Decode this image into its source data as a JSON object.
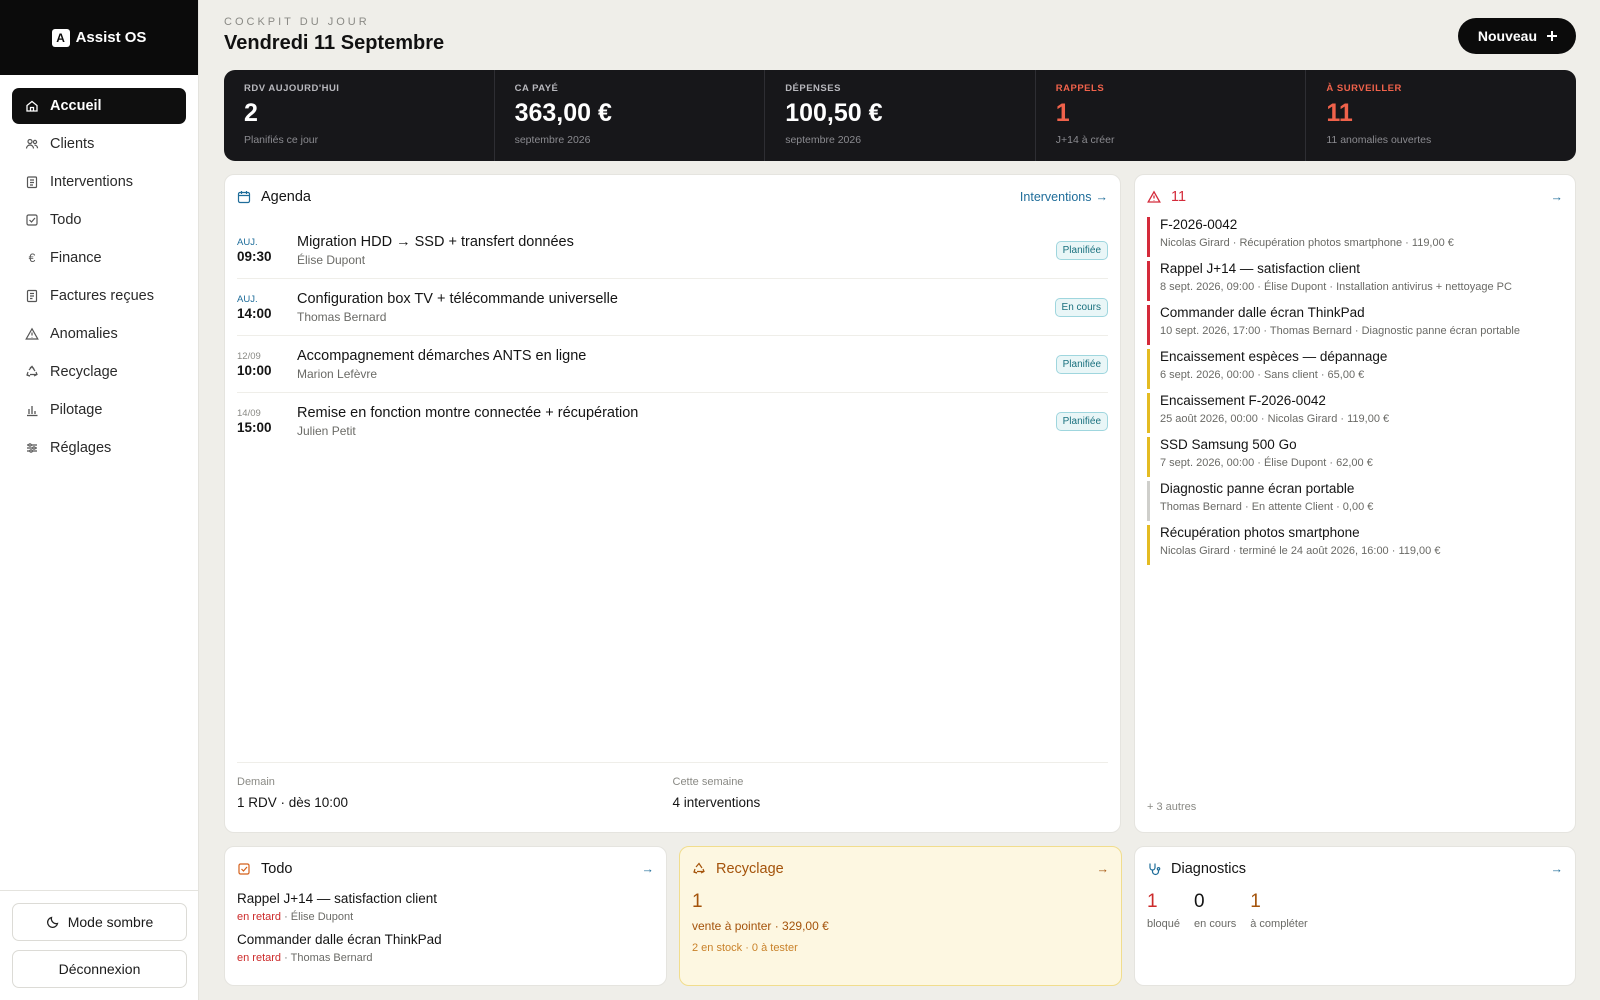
{
  "app": {
    "brand_letter": "A",
    "brand_name": "Assist OS"
  },
  "sidebar": {
    "items": [
      {
        "label": "Accueil",
        "icon": "home-icon",
        "active": true
      },
      {
        "label": "Clients",
        "icon": "users-icon"
      },
      {
        "label": "Interventions",
        "icon": "clipboard-icon"
      },
      {
        "label": "Todo",
        "icon": "checkbox-icon"
      },
      {
        "label": "Finance",
        "icon": "euro-icon"
      },
      {
        "label": "Factures reçues",
        "icon": "receipt-icon"
      },
      {
        "label": "Anomalies",
        "icon": "warning-icon"
      },
      {
        "label": "Recyclage",
        "icon": "recycle-icon"
      },
      {
        "label": "Pilotage",
        "icon": "bar-chart-icon"
      },
      {
        "label": "Réglages",
        "icon": "sliders-icon"
      }
    ],
    "dark_mode_label": "Mode sombre",
    "logout_label": "Déconnexion"
  },
  "header": {
    "kicker": "COCKPIT DU JOUR",
    "title": "Vendredi 11 Septembre",
    "new_button": "Nouveau"
  },
  "kpis": [
    {
      "label": "RDV AUJOURD'HUI",
      "value": "2",
      "sub": "Planifiés ce jour"
    },
    {
      "label": "CA PAYÉ",
      "value": "363,00 €",
      "sub": "septembre 2026"
    },
    {
      "label": "DÉPENSES",
      "value": "100,50 €",
      "sub": "septembre 2026"
    },
    {
      "label": "RAPPELS",
      "value": "1",
      "sub": "J+14 à créer",
      "warn": true
    },
    {
      "label": "À SURVEILLER",
      "value": "11",
      "sub": "11 anomalies ouvertes",
      "warn": true
    }
  ],
  "agenda": {
    "title": "Agenda",
    "link": "Interventions",
    "items": [
      {
        "day": "AUJ.",
        "time": "09:30",
        "title": "Migration HDD → SSD + transfert données",
        "client": "Élise Dupont",
        "status": "Planifiée"
      },
      {
        "day": "AUJ.",
        "time": "14:00",
        "title": "Configuration box TV + télécommande universelle",
        "client": "Thomas Bernard",
        "status": "En cours"
      },
      {
        "day": "12/09",
        "time": "10:00",
        "title": "Accompagnement démarches ANTS en ligne",
        "client": "Marion Lefèvre",
        "status": "Planifiée"
      },
      {
        "day": "14/09",
        "time": "15:00",
        "title": "Remise en fonction montre connectée + récupération",
        "client": "Julien Petit",
        "status": "Planifiée"
      }
    ],
    "footer": {
      "tomorrow_label": "Demain",
      "tomorrow_value": "1 RDV · dès 10:00",
      "week_label": "Cette semaine",
      "week_value": "4 interventions"
    }
  },
  "alerts": {
    "count": "11",
    "items": [
      {
        "title": "F-2026-0042",
        "sub": "Nicolas Girard · Récupération photos smartphone · 119,00 €",
        "severity": "red"
      },
      {
        "title": "Rappel J+14 — satisfaction client",
        "sub": "8 sept. 2026, 09:00 · Élise Dupont · Installation antivirus + nettoyage PC",
        "severity": "red"
      },
      {
        "title": "Commander dalle écran ThinkPad",
        "sub": "10 sept. 2026, 17:00 · Thomas Bernard · Diagnostic panne écran portable",
        "severity": "red"
      },
      {
        "title": "Encaissement espèces — dépannage",
        "sub": "6 sept. 2026, 00:00 · Sans client · 65,00 €",
        "severity": "yellow"
      },
      {
        "title": "Encaissement F-2026-0042",
        "sub": "25 août 2026, 00:00 · Nicolas Girard · 119,00 €",
        "severity": "yellow"
      },
      {
        "title": "SSD Samsung 500 Go",
        "sub": "7 sept. 2026, 00:00 · Élise Dupont · 62,00 €",
        "severity": "yellow"
      },
      {
        "title": "Diagnostic panne écran portable",
        "sub": "Thomas Bernard · En attente Client · 0,00 €",
        "severity": "gray"
      },
      {
        "title": "Récupération photos smartphone",
        "sub": "Nicolas Girard · terminé le 24 août 2026, 16:00 · 119,00 €",
        "severity": "yellow"
      }
    ],
    "more": "+ 3 autres"
  },
  "todo": {
    "title": "Todo",
    "items": [
      {
        "title": "Rappel J+14 — satisfaction client",
        "late": "en retard",
        "who": " · Élise Dupont"
      },
      {
        "title": "Commander dalle écran ThinkPad",
        "late": "en retard",
        "who": " · Thomas Bernard"
      }
    ]
  },
  "recyclage": {
    "title": "Recyclage",
    "count": "1",
    "sub": "vente à pointer · 329,00 €",
    "sub2": "2 en stock · 0 à tester"
  },
  "diagnostics": {
    "title": "Diagnostics",
    "stats": [
      {
        "value": "1",
        "label": "bloqué",
        "color": "#cc2a2a"
      },
      {
        "value": "0",
        "label": "en cours",
        "color": "#141414"
      },
      {
        "value": "1",
        "label": "à compléter",
        "color": "#a4530b"
      }
    ]
  },
  "colors": {
    "accent_dark": "#0b0b0b",
    "link_blue": "#1f6d9a",
    "alert_red": "#d42a3a",
    "warn_orange": "#f0624b",
    "recycle_brown": "#a4530b",
    "recycle_bg": "#fdf7e1"
  }
}
